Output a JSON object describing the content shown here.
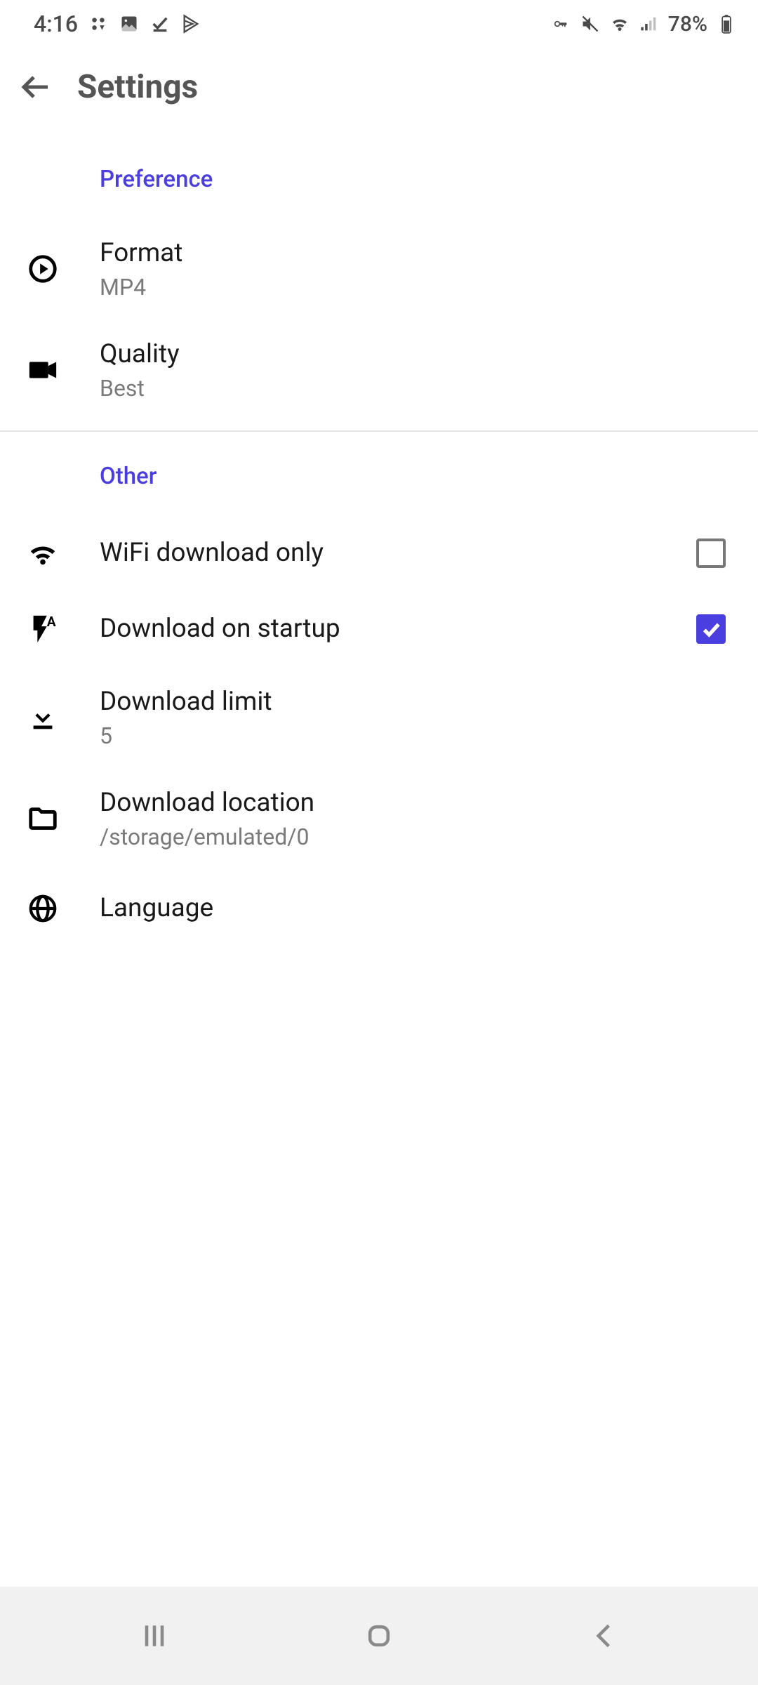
{
  "statusbar": {
    "time": "4:16",
    "battery": "78%"
  },
  "appbar": {
    "title": "Settings"
  },
  "sections": {
    "preference": {
      "header": "Preference",
      "format": {
        "title": "Format",
        "value": "MP4"
      },
      "quality": {
        "title": "Quality",
        "value": "Best"
      }
    },
    "other": {
      "header": "Other",
      "wifi_only": {
        "title": "WiFi download only",
        "checked": false
      },
      "startup": {
        "title": "Download on startup",
        "checked": true
      },
      "limit": {
        "title": "Download limit",
        "value": "5"
      },
      "location": {
        "title": "Download location",
        "value": "/storage/emulated/0"
      },
      "language": {
        "title": "Language"
      }
    }
  },
  "colors": {
    "accent": "#4b3ee0"
  }
}
